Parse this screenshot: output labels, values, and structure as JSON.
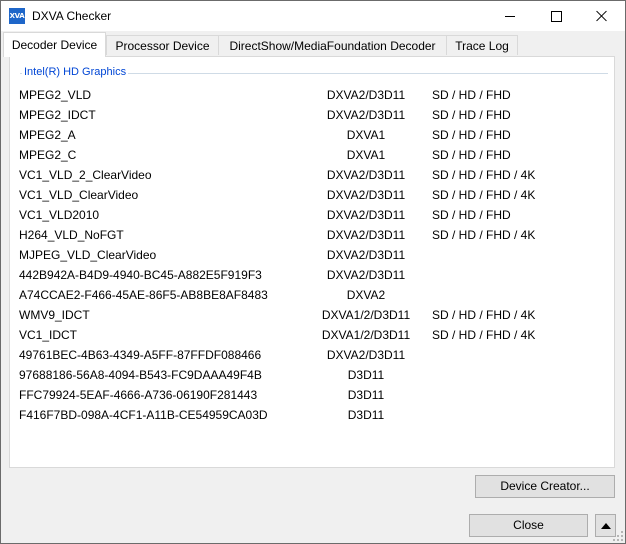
{
  "window": {
    "app_icon": "XVA",
    "title": "DXVA Checker"
  },
  "tabs": [
    {
      "label": "Decoder Device"
    },
    {
      "label": "Processor Device"
    },
    {
      "label": "DirectShow/MediaFoundation Decoder"
    },
    {
      "label": "Trace Log"
    }
  ],
  "group": {
    "title": "Intel(R) HD Graphics"
  },
  "decoders": [
    {
      "name": "MPEG2_VLD",
      "api": "DXVA2/D3D11",
      "res": "SD / HD / FHD"
    },
    {
      "name": "MPEG2_IDCT",
      "api": "DXVA2/D3D11",
      "res": "SD / HD / FHD"
    },
    {
      "name": "MPEG2_A",
      "api": "DXVA1",
      "res": "SD / HD / FHD"
    },
    {
      "name": "MPEG2_C",
      "api": "DXVA1",
      "res": "SD / HD / FHD"
    },
    {
      "name": "VC1_VLD_2_ClearVideo",
      "api": "DXVA2/D3D11",
      "res": "SD / HD / FHD / 4K"
    },
    {
      "name": "VC1_VLD_ClearVideo",
      "api": "DXVA2/D3D11",
      "res": "SD / HD / FHD / 4K"
    },
    {
      "name": "VC1_VLD2010",
      "api": "DXVA2/D3D11",
      "res": "SD / HD / FHD"
    },
    {
      "name": "H264_VLD_NoFGT",
      "api": "DXVA2/D3D11",
      "res": "SD / HD / FHD / 4K"
    },
    {
      "name": "MJPEG_VLD_ClearVideo",
      "api": "DXVA2/D3D11",
      "res": ""
    },
    {
      "name": "442B942A-B4D9-4940-BC45-A882E5F919F3",
      "api": "DXVA2/D3D11",
      "res": ""
    },
    {
      "name": "A74CCAE2-F466-45AE-86F5-AB8BE8AF8483",
      "api": "DXVA2",
      "res": ""
    },
    {
      "name": "WMV9_IDCT",
      "api": "DXVA1/2/D3D11",
      "res": "SD / HD / FHD / 4K"
    },
    {
      "name": "VC1_IDCT",
      "api": "DXVA1/2/D3D11",
      "res": "SD / HD / FHD / 4K"
    },
    {
      "name": "49761BEC-4B63-4349-A5FF-87FFDF088466",
      "api": "DXVA2/D3D11",
      "res": ""
    },
    {
      "name": "97688186-56A8-4094-B543-FC9DAAA49F4B",
      "api": "D3D11",
      "res": ""
    },
    {
      "name": "FFC79924-5EAF-4666-A736-06190F281443",
      "api": "D3D11",
      "res": ""
    },
    {
      "name": "F416F7BD-098A-4CF1-A11B-CE54959CA03D",
      "api": "D3D11",
      "res": ""
    }
  ],
  "buttons": {
    "device_creator": "Device Creator...",
    "close": "Close"
  },
  "icons": {
    "minimize": "minimize-icon",
    "maximize": "maximize-icon",
    "close": "close-icon",
    "expand_up": "triangle-up-icon",
    "resize": "resize-grip-icon"
  },
  "colors": {
    "group_title": "#0046d5",
    "app_icon_bg": "#1e66c9"
  }
}
